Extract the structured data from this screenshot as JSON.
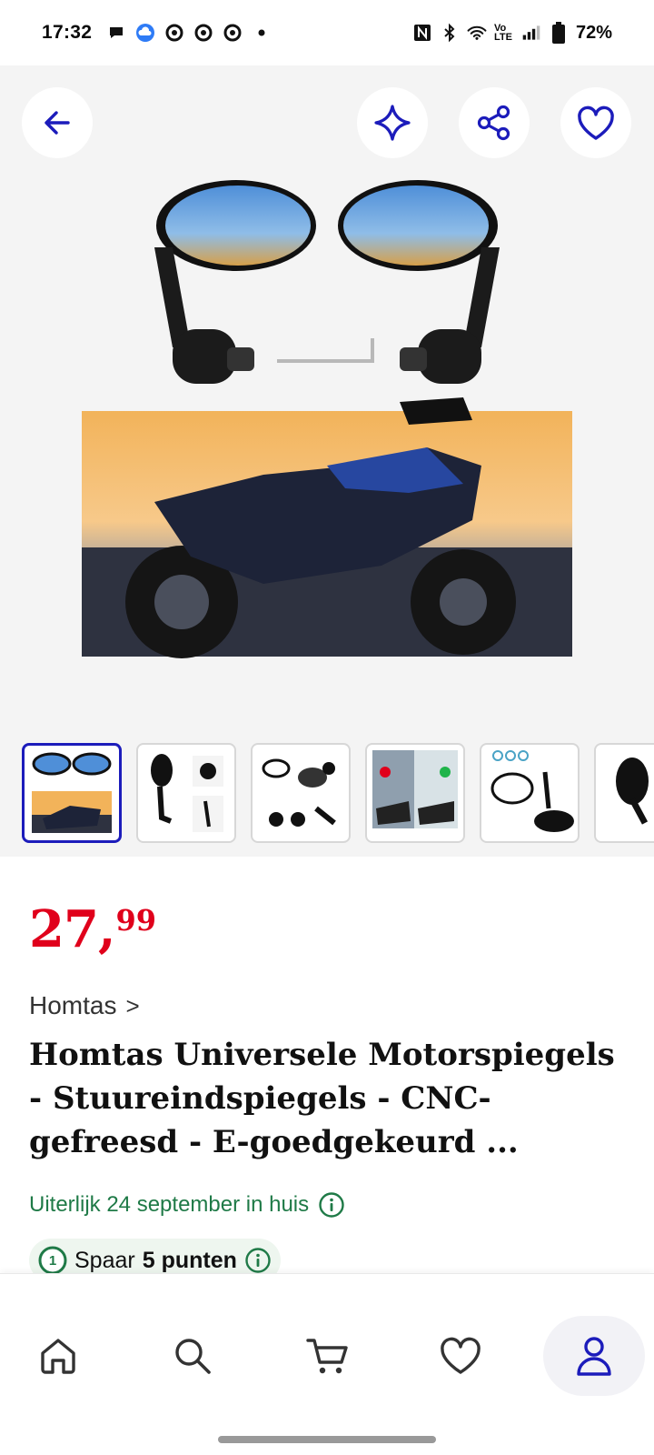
{
  "status_bar": {
    "time": "17:32",
    "battery": "72%",
    "network": "Vo LTE",
    "left_icons": [
      "chat-icon",
      "cloud-icon",
      "chrome-icon",
      "chrome-icon",
      "chrome-icon",
      "dot-icon"
    ],
    "right_icons": [
      "nfc-icon",
      "bluetooth-icon",
      "wifi-icon",
      "volte-icon",
      "signal-icon",
      "battery-icon"
    ]
  },
  "hero": {
    "buttons": [
      "back-arrow-icon",
      "sparkle-icon",
      "share-icon",
      "heart-icon"
    ],
    "image_alt": "Motorspiegels"
  },
  "thumbnails": [
    "thumb-1",
    "thumb-2",
    "thumb-3",
    "thumb-4",
    "thumb-5",
    "thumb-6"
  ],
  "product": {
    "price_int": "27",
    "price_sep": ",",
    "price_cents": "99",
    "brand": "Homtas",
    "brand_chevron": ">",
    "title": "Homtas Universele Motorspiegels - Stuureindspiegels - CNC-gefreesd - E-goedgekeurd ...",
    "delivery": "Uiterlijk 24 september in huis",
    "points_prefix": "Spaar",
    "points_value": "5 punten",
    "points_badge": "1"
  },
  "bottom_nav": {
    "items": [
      "home-icon",
      "search-icon",
      "cart-icon",
      "heart-icon",
      "account-icon"
    ]
  },
  "colors": {
    "accent": "#1c1cbb",
    "price": "#e0001b",
    "delivery": "#1f7a47"
  }
}
